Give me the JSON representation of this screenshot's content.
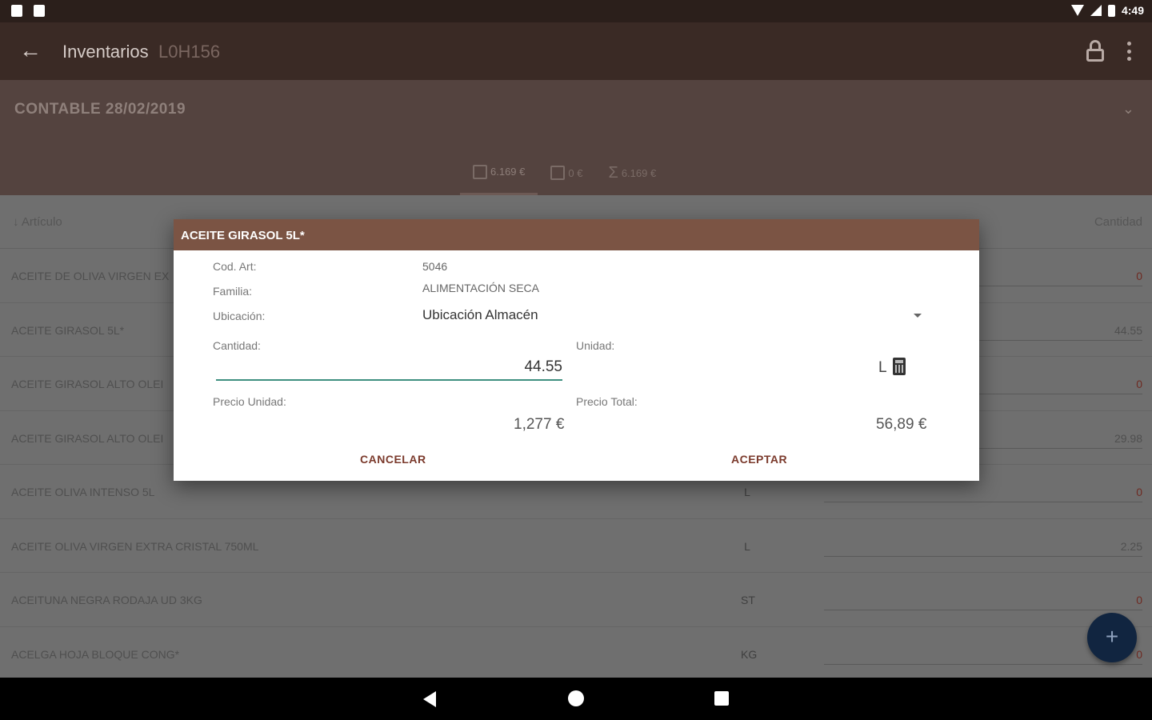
{
  "status_bar": {
    "time": "4:49"
  },
  "app_bar": {
    "title": "Inventarios",
    "subtitle": "L0H156"
  },
  "header": {
    "period": "CONTABLE 28/02/2019",
    "tabs": [
      {
        "icon": "edit-icon",
        "label": "6.169 €"
      },
      {
        "icon": "edit-icon",
        "label": "0 €"
      },
      {
        "icon": "sigma-icon",
        "label": "6.169 €"
      }
    ]
  },
  "list": {
    "col_article": "↓ Artículo",
    "col_qty": "Cantidad",
    "rows": [
      {
        "name": "ACEITE DE OLIVA VIRGEN EX",
        "unit": "",
        "qty": "0"
      },
      {
        "name": "ACEITE GIRASOL 5L*",
        "unit": "",
        "qty": "44.55"
      },
      {
        "name": "ACEITE GIRASOL ALTO OLEI",
        "unit": "",
        "qty": "0"
      },
      {
        "name": "ACEITE GIRASOL ALTO OLEI",
        "unit": "",
        "qty": "29.98"
      },
      {
        "name": "ACEITE OLIVA INTENSO 5L",
        "unit": "L",
        "qty": "0"
      },
      {
        "name": "ACEITE OLIVA VIRGEN EXTRA CRISTAL 750ML",
        "unit": "L",
        "qty": "2.25"
      },
      {
        "name": "ACEITUNA NEGRA RODAJA UD 3KG",
        "unit": "ST",
        "qty": "0"
      },
      {
        "name": "ACELGA HOJA BLOQUE CONG*",
        "unit": "KG",
        "qty": "0"
      }
    ]
  },
  "dialog": {
    "title": "ACEITE GIRASOL 5L*",
    "cod_label": "Cod. Art:",
    "cod_value": "5046",
    "familia_label": "Familia:",
    "familia_value": "ALIMENTACIÓN SECA",
    "ubicacion_label": "Ubicación:",
    "ubicacion_value": "Ubicación Almacén",
    "cantidad_label": "Cantidad:",
    "cantidad_value": "44.55",
    "unidad_label": "Unidad:",
    "unidad_value": "L",
    "precio_unidad_label": "Precio Unidad:",
    "precio_unidad_value": "1,277 €",
    "precio_total_label": "Precio Total:",
    "precio_total_value": "56,89 €",
    "cancel_label": "CANCELAR",
    "accept_label": "ACEPTAR"
  },
  "fab": {
    "label": "+"
  }
}
